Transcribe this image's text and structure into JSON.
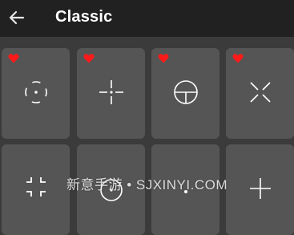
{
  "header": {
    "title": "Classic",
    "back_icon": "arrow-left-icon"
  },
  "crosshairs": [
    {
      "favorite": true,
      "icon": "dashed-circle-dot-crosshair-icon"
    },
    {
      "favorite": true,
      "icon": "dot-cross-crosshair-icon"
    },
    {
      "favorite": true,
      "icon": "circle-t-crosshair-icon"
    },
    {
      "favorite": true,
      "icon": "x-crosshair-icon"
    },
    {
      "favorite": false,
      "icon": "corner-brackets-crosshair-icon"
    },
    {
      "favorite": false,
      "icon": "circle-crosshair-icon"
    },
    {
      "favorite": false,
      "icon": "dot-crosshair-icon"
    },
    {
      "favorite": false,
      "icon": "cross-crosshair-icon"
    }
  ],
  "watermark": "新意手游 • SJXINYI.COM",
  "colors": {
    "topbar": "#212121",
    "background": "#3b3b3b",
    "tile": "#555555",
    "favorite": "#ff1a1a"
  }
}
